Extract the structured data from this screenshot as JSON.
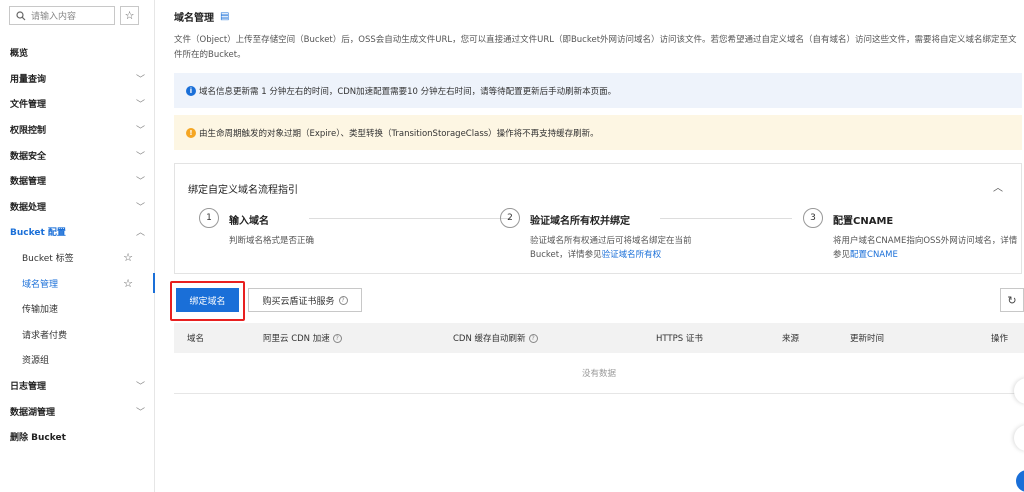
{
  "sidebar": {
    "search_placeholder": "请输入内容",
    "items": [
      {
        "label": "概览",
        "chevron": ""
      },
      {
        "label": "用量查询",
        "chevron": "﹀"
      },
      {
        "label": "文件管理",
        "chevron": "﹀"
      },
      {
        "label": "权限控制",
        "chevron": "﹀"
      },
      {
        "label": "数据安全",
        "chevron": "﹀"
      },
      {
        "label": "数据管理",
        "chevron": "﹀"
      },
      {
        "label": "数据处理",
        "chevron": "﹀"
      },
      {
        "label": "Bucket 配置",
        "chevron": "︿"
      }
    ],
    "sub_items": [
      {
        "label": "Bucket 标签"
      },
      {
        "label": "域名管理"
      },
      {
        "label": "传输加速"
      },
      {
        "label": "请求者付费"
      },
      {
        "label": "资源组"
      }
    ],
    "bottom_items": [
      {
        "label": "日志管理",
        "chevron": "﹀"
      },
      {
        "label": "数据湖管理",
        "chevron": "﹀"
      },
      {
        "label": "删除 Bucket",
        "chevron": ""
      }
    ]
  },
  "main": {
    "title": "域名管理",
    "description": "文件（Object）上传至存储空间（Bucket）后，OSS会自动生成文件URL，您可以直接通过文件URL（即Bucket外网访问域名）访问该文件。若您希望通过自定义域名（自有域名）访问这些文件，需要将自定义域名绑定至文件所在的Bucket。",
    "info_alert": "域名信息更新需 1 分钟左右的时间，CDN加速配置需要10 分钟左右时间，请等待配置更新后手动刷新本页面。",
    "warn_alert": "由生命周期触发的对象过期（Expire）、类型转换（TransitionStorageClass）操作将不再支持缓存刷新。",
    "guide": {
      "title": "绑定自定义域名流程指引",
      "steps": [
        {
          "num": "1",
          "title": "输入域名",
          "desc": "判断域名格式是否正确",
          "desc_link": ""
        },
        {
          "num": "2",
          "title": "验证域名所有权并绑定",
          "desc": "验证域名所有权通过后可将域名绑定在当前Bucket，详情参见",
          "desc_link": "验证域名所有权"
        },
        {
          "num": "3",
          "title": "配置CNAME",
          "desc": "将用户域名CNAME指向OSS外网访问域名，详情参见",
          "desc_link": "配置CNAME"
        }
      ]
    },
    "toolbar": {
      "bind_button": "绑定域名",
      "buy_cert_button": "购买云盾证书服务"
    },
    "table": {
      "columns": [
        "域名",
        "阿里云 CDN 加速",
        "CDN 缓存自动刷新",
        "HTTPS 证书",
        "来源",
        "更新时间",
        "操作"
      ],
      "empty_text": "没有数据"
    }
  }
}
